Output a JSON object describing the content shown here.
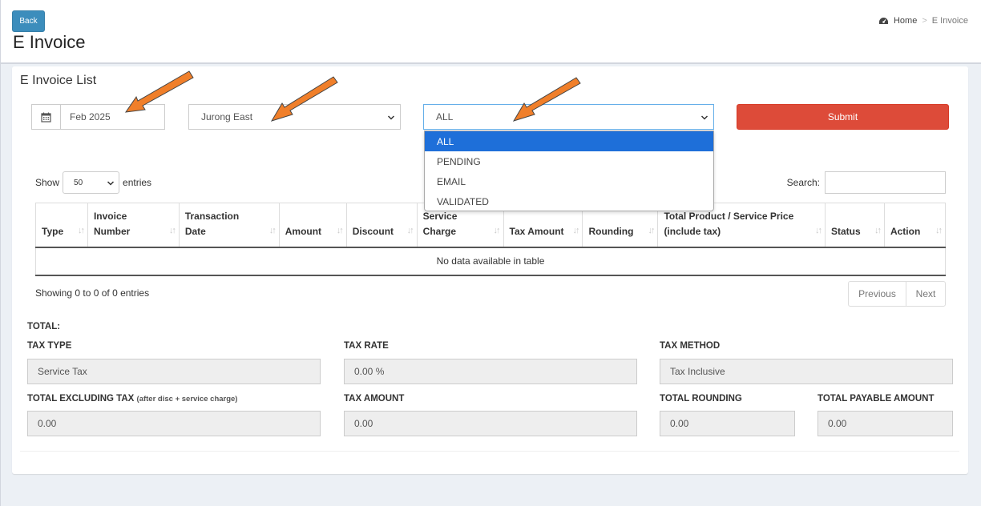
{
  "header": {
    "back_label": "Back",
    "page_title": "E Invoice",
    "breadcrumb": [
      "Home",
      "E Invoice"
    ]
  },
  "box": {
    "title": "E Invoice List"
  },
  "filters": {
    "date_value": "Feb 2025",
    "location_value": "Jurong East",
    "status_value": "ALL",
    "submit_label": "Submit",
    "status_options": [
      "ALL",
      "PENDING",
      "EMAIL",
      "VALIDATED"
    ],
    "status_selected_index": 0
  },
  "table_controls": {
    "show_label": "Show",
    "page_length": "50",
    "entries_label": "entries",
    "search_label": "Search:",
    "search_value": ""
  },
  "table": {
    "columns": [
      "Type",
      "Invoice Number",
      "Transaction Date",
      "Amount",
      "Discount",
      "Service Charge",
      "Tax Amount",
      "Rounding",
      "Total Product / Service Price (include tax)",
      "Status",
      "Action"
    ],
    "empty_message": "No data available in table",
    "info": "Showing 0 to 0 of 0 entries",
    "prev_label": "Previous",
    "next_label": "Next"
  },
  "totals": {
    "heading": "TOTAL:",
    "tax_type_label": "TAX TYPE",
    "tax_type_value": "Service Tax",
    "tax_rate_label": "TAX RATE",
    "tax_rate_value": "0.00 %",
    "tax_method_label": "TAX METHOD",
    "tax_method_value": "Tax Inclusive",
    "total_excl_label": "TOTAL EXCLUDING TAX",
    "total_excl_note": "(after disc + service charge)",
    "total_excl_value": "0.00",
    "tax_amount_label": "TAX AMOUNT",
    "tax_amount_value": "0.00",
    "total_rounding_label": "TOTAL ROUNDING",
    "total_rounding_value": "0.00",
    "total_payable_label": "TOTAL PAYABLE AMOUNT",
    "total_payable_value": "0.00"
  },
  "colors": {
    "primary": "#3c8dbc",
    "danger": "#dd4b39",
    "dropdown_highlight": "#1e6fd9",
    "annotation_arrow": "#f07f2a"
  },
  "icons": [
    "dashboard-icon",
    "calendar-icon",
    "chevron-down-icon",
    "sort-icon",
    "annotation-arrow"
  ]
}
